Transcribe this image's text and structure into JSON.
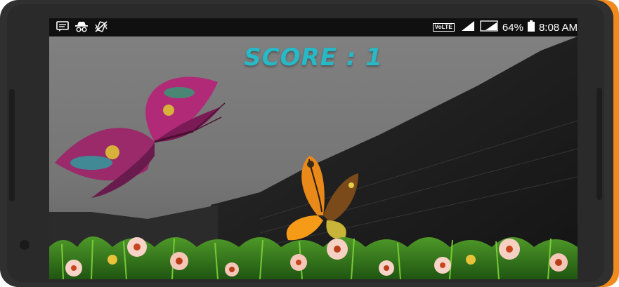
{
  "status_bar": {
    "icons_left": [
      "message-icon",
      "incognito-icon",
      "no-vibrate-icon"
    ],
    "network_label": "VoLTE",
    "sim1": "1",
    "sim2": "2",
    "battery": "64%",
    "time": "8:08 AM"
  },
  "game": {
    "score_label": "SCORE : 1",
    "butterflies": [
      "purple-butterfly",
      "orange-butterfly"
    ]
  },
  "colors": {
    "score": "#26b9c7",
    "phone_body": "#303030",
    "phone_accent": "#f08a1c",
    "sky": "#8a8a8a"
  }
}
